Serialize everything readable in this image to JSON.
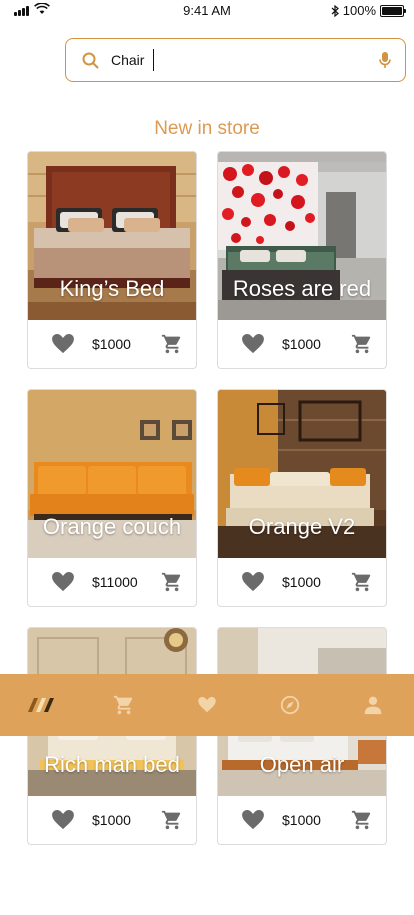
{
  "status_bar": {
    "time": "9:41 AM",
    "battery": "100%",
    "battery_level": 1.0
  },
  "search": {
    "value": "Chair",
    "placeholder": ""
  },
  "section_title": "New in store",
  "products": [
    {
      "name": "King’s Bed",
      "price": "$1000"
    },
    {
      "name": "Roses are red",
      "price": "$1000"
    },
    {
      "name": "Orange couch",
      "price": "$11000"
    },
    {
      "name": "Orange V2",
      "price": "$1000"
    },
    {
      "name": "Rich man bed",
      "price": "$1000"
    },
    {
      "name": "Open air",
      "price": "$1000"
    }
  ],
  "bottom_nav": [
    "home-logo-icon",
    "cart-icon",
    "heart-icon",
    "explore-icon",
    "profile-icon"
  ],
  "colors": {
    "accent": "#dea25b",
    "accent_border": "#d2943f",
    "title": "#dd9a52",
    "icon_gray": "#6b6b6b"
  }
}
